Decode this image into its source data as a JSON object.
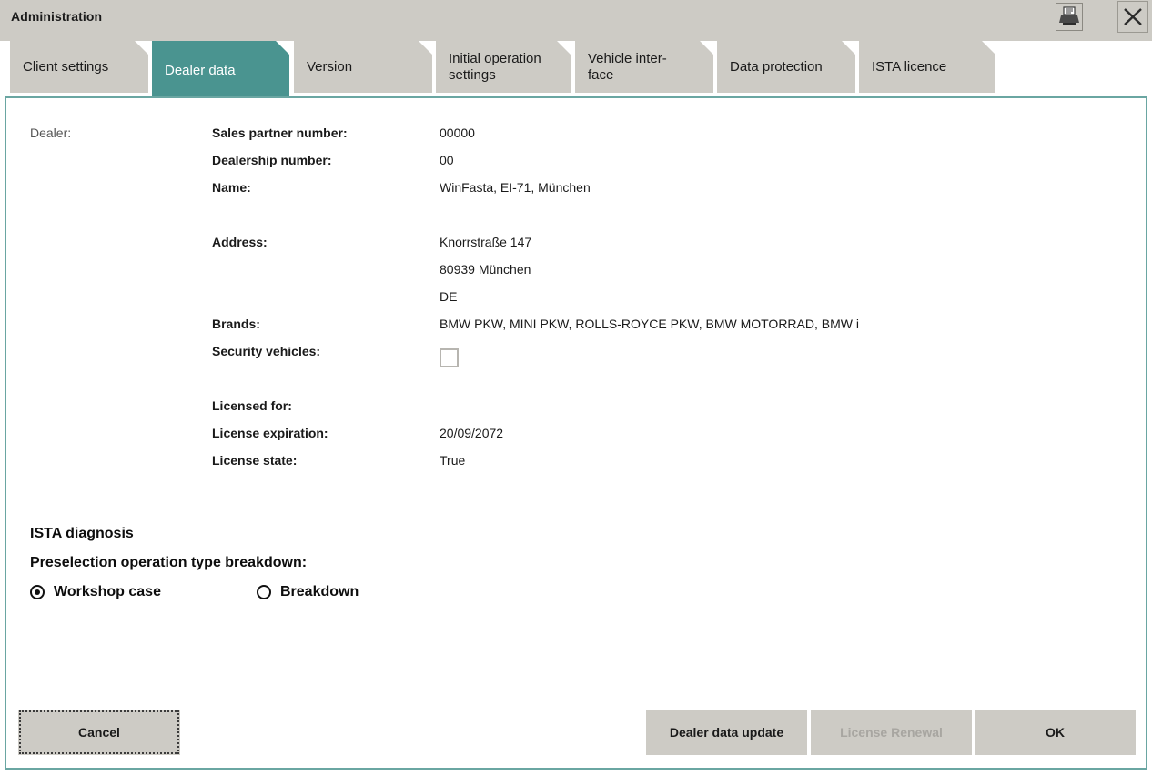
{
  "window": {
    "title": "Administration",
    "print_icon": "printer-icon",
    "close_icon": "close-icon"
  },
  "tabs": [
    {
      "label": "Client settings",
      "active": false
    },
    {
      "label": "Dealer data",
      "active": true
    },
    {
      "label": "Version",
      "active": false
    },
    {
      "label": "Initial operation settings",
      "active": false
    },
    {
      "label": "Vehicle inter-face",
      "active": false
    },
    {
      "label": "Data protection",
      "active": false
    },
    {
      "label": "ISTA licence",
      "active": false
    }
  ],
  "dealer": {
    "section_label": "Dealer:",
    "fields": [
      {
        "label": "Sales partner number:",
        "value": "00000"
      },
      {
        "label": "Dealership number:",
        "value": "00"
      },
      {
        "label": "Name:",
        "value": "WinFasta, EI-71, München"
      },
      {
        "label": "Address:",
        "value": "Knorrstraße 147"
      },
      {
        "label": "",
        "value": "80939 München"
      },
      {
        "label": "",
        "value": "DE"
      },
      {
        "label": "Brands:",
        "value": "BMW PKW, MINI PKW, ROLLS-ROYCE PKW, BMW MOTORRAD, BMW i"
      },
      {
        "label": "Security vehicles:",
        "value": ""
      },
      {
        "label": "Licensed for:",
        "value": ""
      },
      {
        "label": "License expiration:",
        "value": "20/09/2072"
      },
      {
        "label": "License state:",
        "value": "True"
      }
    ],
    "security_vehicles_checked": false
  },
  "ista": {
    "heading": "ISTA diagnosis",
    "preselection_label": "Preselection operation type breakdown:",
    "options": [
      {
        "label": "Workshop case",
        "selected": true
      },
      {
        "label": "Breakdown",
        "selected": false
      }
    ]
  },
  "footer": {
    "cancel_label": "Cancel",
    "dealer_update_label": "Dealer data update",
    "license_renewal_label": "License Renewal",
    "ok_label": "OK"
  },
  "colors": {
    "accent_teal": "#4a9490",
    "panel_border": "#6aa6a2",
    "chrome_gray": "#cdcbc5"
  }
}
